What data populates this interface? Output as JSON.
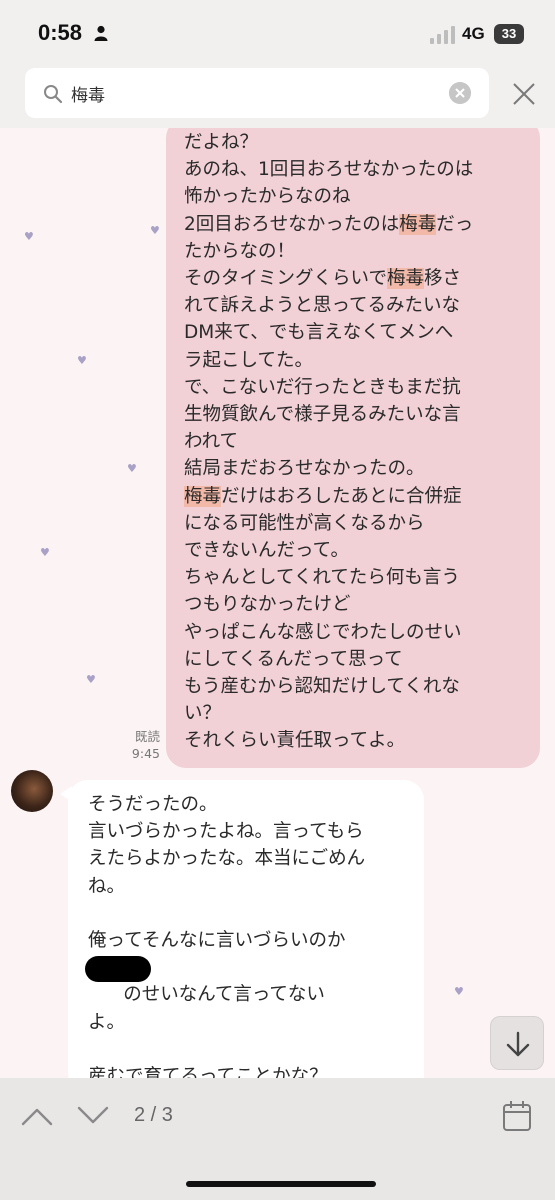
{
  "status_bar": {
    "time": "0:58",
    "network": "4G",
    "battery": "33"
  },
  "search": {
    "value": "梅毒",
    "placeholder": ""
  },
  "chat": {
    "outgoing": {
      "segments": [
        {
          "text": "だよね？\nあのね、1回目おろせなかったのは\n怖かったからなのね\n2回目おろせなかったのは",
          "hl": false
        },
        {
          "text": "梅毒",
          "hl": true
        },
        {
          "text": "だっ\nたからなの！\nそのタイミングくらいで",
          "hl": false
        },
        {
          "text": "梅毒",
          "hl": true
        },
        {
          "text": "移さ\nれて訴えようと思ってるみたいな\nDM来て、でも言えなくてメンへ\nラ起こしてた。\nで、こないだ行ったときもまだ抗\n生物質飲んで様子見るみたいな言\nわれて\n結局まだおろせなかったの。\n",
          "hl": false
        },
        {
          "text": "梅毒",
          "hl": true
        },
        {
          "text": "だけはおろしたあとに合併症\nになる可能性が高くなるから\nできないんだって。\nちゃんとしてくれてたら何も言う\nつもりなかったけど\nやっぱこんな感じでわたしのせい\nにしてくるんだって思って\nもう産むから認知だけしてくれな\nい？\nそれくらい責任取ってよ。",
          "hl": false
        }
      ],
      "read_label": "既読",
      "time": "9:45"
    },
    "incoming": {
      "segments": [
        {
          "text": "そうだったの。\n言いづらかったよね。言ってもら\nえたらよかったな。本当にごめん\nね。\n\n俺ってそんなに言いづらいのか\nな。\n      のせいなんて言ってない\nよ。\n\n産むで育てるってことかな？",
          "hl": false
        }
      ]
    }
  },
  "toolbar": {
    "page_indicator": "2 / 3"
  },
  "icons": [
    "person-icon",
    "signal-icon",
    "search-icon",
    "clear-icon",
    "close-icon",
    "heart-icon",
    "arrow-down-icon",
    "chevron-up-icon",
    "chevron-down-icon",
    "calendar-icon"
  ],
  "colors": {
    "outgoing_bubble": "#f1d0d6",
    "highlight": "#f3b9a8",
    "background": "#fcf4f4",
    "heart": "#a9a1c6"
  }
}
